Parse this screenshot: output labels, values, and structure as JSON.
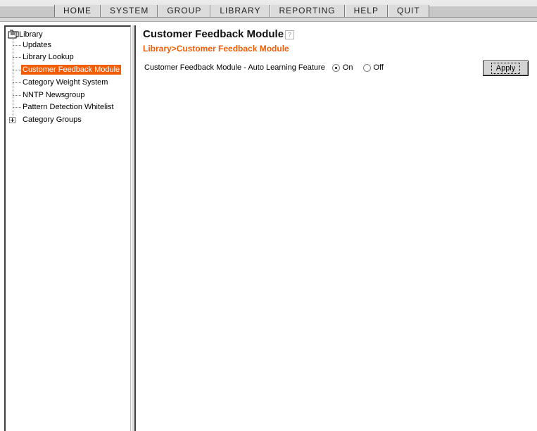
{
  "menu": {
    "items": [
      "HOME",
      "SYSTEM",
      "GROUP",
      "LIBRARY",
      "REPORTING",
      "HELP",
      "QUIT"
    ]
  },
  "tree": {
    "root": "Library",
    "items": [
      {
        "label": "Updates"
      },
      {
        "label": "Library Lookup"
      },
      {
        "label": "Customer Feedback Module",
        "selected": true
      },
      {
        "label": "Category Weight System"
      },
      {
        "label": "NNTP Newsgroup"
      },
      {
        "label": "Pattern Detection Whitelist"
      },
      {
        "label": "Category Groups",
        "expandable": true
      }
    ]
  },
  "main": {
    "title": "Customer Feedback Module",
    "breadcrumb": "Library>Customer Feedback Module",
    "setting_label": "Customer Feedback Module - Auto Learning Feature",
    "option_on": "On",
    "option_off": "Off",
    "selected_option": "On",
    "apply_label": "Apply"
  },
  "colors": {
    "accent": "#f25c05"
  },
  "icons": [
    "folder-icon",
    "help-icon",
    "expand-plus-icon"
  ]
}
